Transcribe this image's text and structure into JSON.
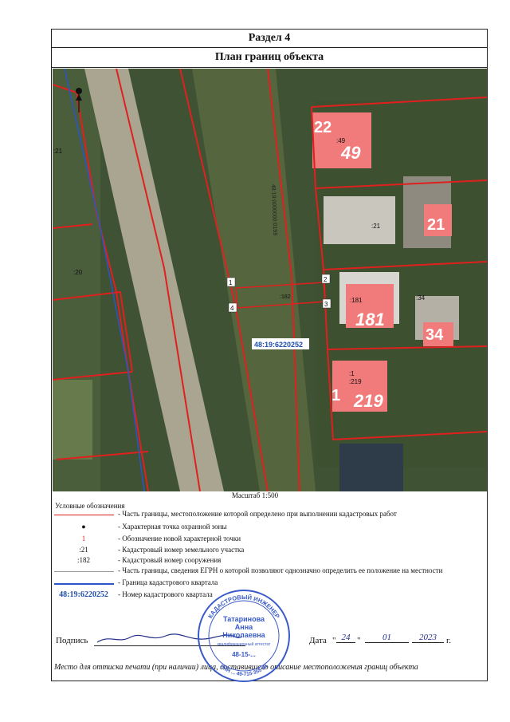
{
  "section_title": "Раздел 4",
  "plan_title": "План границ объекта",
  "map": {
    "parcel_labels": [
      ":21",
      ":20",
      ":49",
      ":21",
      ":181",
      ":34",
      ":1",
      ":219",
      ":182"
    ],
    "building_numbers": [
      "22",
      "49",
      "21",
      "181",
      "34",
      "1",
      "219"
    ],
    "point_numbers": [
      "1",
      "2",
      "3",
      "4"
    ],
    "quarter_label": "48:19:6220252",
    "road_label": "48:19:0000000:0159"
  },
  "scale": "Масштаб 1:500",
  "legend": {
    "title": "Условные обозначения",
    "items": [
      {
        "symbol": "",
        "text": "- Часть границы, местоположение которой определено при выполнении кадастровых работ"
      },
      {
        "symbol": "●",
        "text": "- Характерная точка охранной зоны"
      },
      {
        "symbol": "1",
        "text": "- Обозначение новой характерной точки"
      },
      {
        "symbol": ":21",
        "text": "- Кадастровый номер земельного участка"
      },
      {
        "symbol": ":182",
        "text": "- Кадастровый номер сооружения"
      },
      {
        "symbol": "",
        "text": "- Часть границы, сведения ЕГРН о которой позволяют однозначно определить ее положение на местности"
      },
      {
        "symbol": "",
        "text": "- Граница кадастрового квартала"
      },
      {
        "symbol": "48:19:6220252",
        "text": "- Номер кадастрового квартала"
      }
    ]
  },
  "signature": {
    "label": "Подпись",
    "date_label": "Дата",
    "day": "24",
    "month": "01",
    "year": "2023",
    "year_suffix": "г."
  },
  "footer": "Место для оттиска печати (при наличии) лица, составившего описание местоположения границ объекта",
  "stamp": {
    "outer_text": "КАДАСТРОВЫЙ ИНЖЕНЕР",
    "name_line1": "Татаринова",
    "name_line2": "Анна",
    "name_line3": "Николаевна",
    "inner_text": "квалификационный аттестат",
    "number": "48-15-...",
    "bottom_text": "ИНН ... 49-715-355 94"
  },
  "colors": {
    "boundary": "#e0201e",
    "quarter": "#2a55c8",
    "accent": "#1f4fae"
  }
}
